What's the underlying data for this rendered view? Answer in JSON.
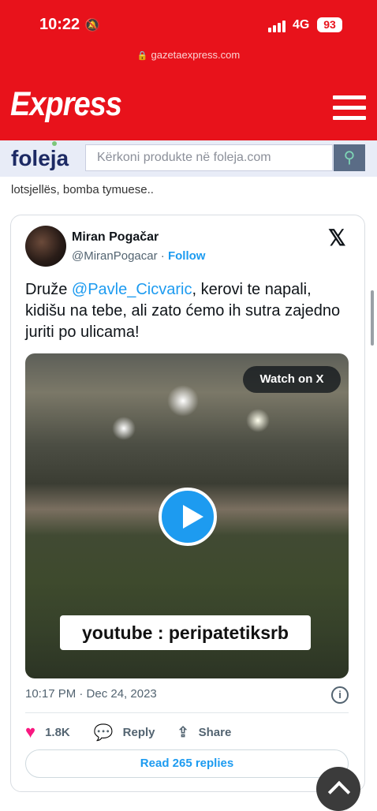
{
  "status_bar": {
    "time": "10:22",
    "network": "4G",
    "battery": "93"
  },
  "browser": {
    "url": "gazetaexpress.com"
  },
  "site": {
    "logo_text": "Express",
    "brand_color": "#e8121b"
  },
  "ad_bar": {
    "logo_text": "foleja",
    "search_placeholder": "Kërkoni produkte në foleja.com"
  },
  "article": {
    "snippet": "lotsjellës, bomba tymuese.."
  },
  "tweet": {
    "author_name": "Miran Pogačar",
    "author_handle": "@MiranPogacar",
    "separator": "·",
    "follow_label": "Follow",
    "text_part1": "Druže ",
    "mention": "@Pavle_Cicvaric",
    "text_part2": ", kerovi te napali, kidišu na tebe, ali zato ćemo ih sutra zajedno juriti po ulicama!",
    "watch_label": "Watch on X",
    "video_overlay_text": "youtube : peripatetiksrb",
    "timestamp": "10:17 PM · Dec 24, 2023",
    "likes": "1.8K",
    "reply_label": "Reply",
    "share_label": "Share",
    "read_replies_label": "Read 265 replies",
    "accent_color": "#1d9bf0"
  }
}
